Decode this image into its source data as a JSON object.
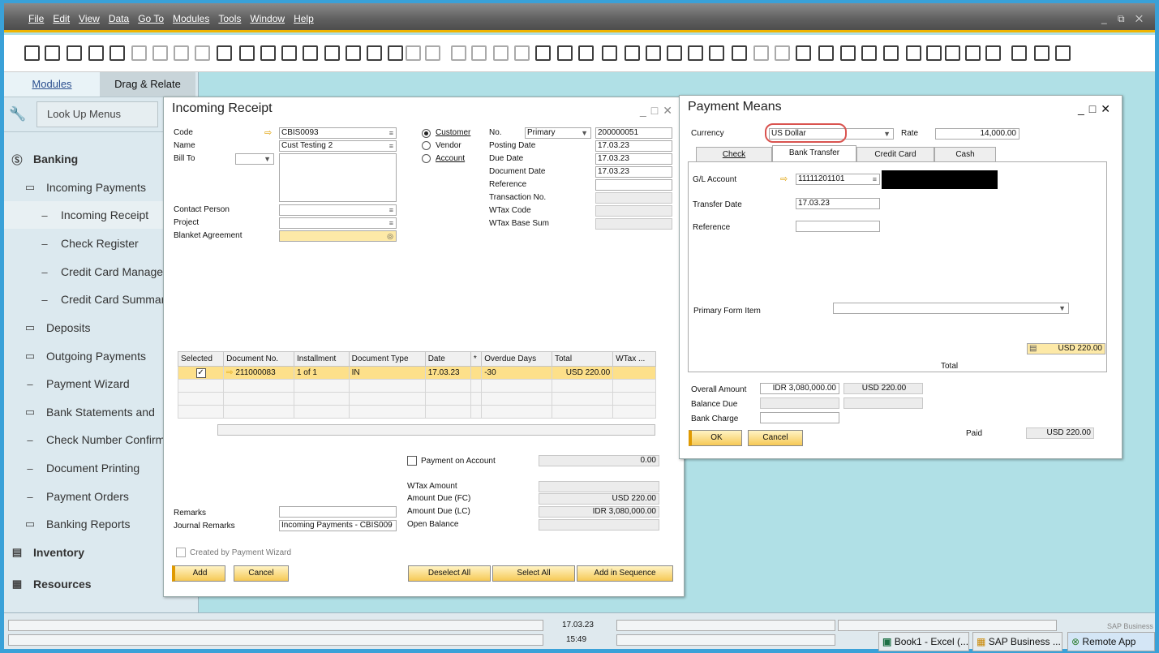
{
  "menubar": {
    "items": [
      "File",
      "Edit",
      "View",
      "Data",
      "Go To",
      "Modules",
      "Tools",
      "Window",
      "Help"
    ],
    "controls": "_ ⧉ ✕"
  },
  "sidebar": {
    "tabs": [
      "Modules",
      "Drag & Relate"
    ],
    "lookup_menus": "Look Up Menus",
    "items": [
      {
        "label": "Banking",
        "icon": "dollar-circle-icon"
      },
      {
        "label": "Incoming Payments",
        "icon": "folder-icon"
      },
      {
        "label": "Incoming Receipt",
        "icon": "dash-icon"
      },
      {
        "label": "Check Register",
        "icon": "dash-icon"
      },
      {
        "label": "Credit Card Management",
        "icon": "dash-icon"
      },
      {
        "label": "Credit Card Summary",
        "icon": "dash-icon"
      },
      {
        "label": "Deposits",
        "icon": "folder-icon"
      },
      {
        "label": "Outgoing Payments",
        "icon": "folder-icon"
      },
      {
        "label": "Payment Wizard",
        "icon": "dash-icon"
      },
      {
        "label": "Bank Statements and",
        "icon": "folder-icon"
      },
      {
        "label": "Check Number Confirmation",
        "icon": "dash-icon"
      },
      {
        "label": "Document Printing",
        "icon": "dash-icon"
      },
      {
        "label": "Payment Orders",
        "icon": "dash-icon"
      },
      {
        "label": "Banking Reports",
        "icon": "folder-icon"
      },
      {
        "label": "Inventory",
        "icon": "inventory-icon"
      },
      {
        "label": "Resources",
        "icon": "resources-icon"
      }
    ]
  },
  "incoming_receipt": {
    "title": "Incoming Receipt",
    "code_label": "Code",
    "code_value": "CBIS0093",
    "name_label": "Name",
    "name_value": "Cust Testing 2",
    "billto_label": "Bill To",
    "contact_label": "Contact Person",
    "project_label": "Project",
    "blanket_label": "Blanket Agreement",
    "radio_customer": "Customer",
    "radio_vendor": "Vendor",
    "radio_account": "Account",
    "no_label": "No.",
    "no_series": "Primary",
    "no_value": "200000051",
    "posting_label": "Posting Date",
    "posting_value": "17.03.23",
    "due_label": "Due Date",
    "due_value": "17.03.23",
    "docdate_label": "Document Date",
    "docdate_value": "17.03.23",
    "reference_label": "Reference",
    "transno_label": "Transaction No.",
    "wtaxcode_label": "WTax Code",
    "wtaxbase_label": "WTax Base Sum",
    "table": {
      "columns": [
        "Selected",
        "Document No.",
        "Installment",
        "Document Type",
        "Date",
        "*",
        "Overdue Days",
        "Total",
        "WTax ..."
      ],
      "row": {
        "checked": "✓",
        "doc_no": "211000083",
        "installment": "1 of 1",
        "doc_type": "IN",
        "date": "17.03.23",
        "star": "",
        "overdue": "-30",
        "total": "USD 220.00",
        "wtax": ""
      }
    },
    "payment_on_account": "Payment on Account",
    "payment_on_account_value": "0.00",
    "wtax_amount_label": "WTax Amount",
    "amount_due_fc_label": "Amount Due (FC)",
    "amount_due_fc_value": "USD 220.00",
    "amount_due_lc_label": "Amount Due (LC)",
    "amount_due_lc_value": "IDR 3,080,000.00",
    "open_balance_label": "Open Balance",
    "remarks_label": "Remarks",
    "journal_remarks_label": "Journal Remarks",
    "journal_remarks_value": "Incoming Payments - CBIS009",
    "created_by_wizard": "Created by Payment Wizard",
    "buttons": {
      "add": "Add",
      "cancel": "Cancel",
      "deselect_all": "Deselect All",
      "select_all": "Select All",
      "add_in_sequence": "Add in Sequence"
    }
  },
  "payment_means": {
    "title": "Payment Means",
    "currency_label": "Currency",
    "currency_value": "US Dollar",
    "rate_label": "Rate",
    "rate_value": "14,000.00",
    "tabs": [
      "Check",
      "Bank Transfer",
      "Credit Card",
      "Cash"
    ],
    "active_tab": "Bank Transfer",
    "gl_account_label": "G/L Account",
    "gl_account_value": "11111201101",
    "transfer_date_label": "Transfer Date",
    "transfer_date_value": "17.03.23",
    "reference_label": "Reference",
    "primary_form_item_label": "Primary Form Item",
    "total_value": "USD 220.00",
    "total_label": "Total",
    "overall_amount_label": "Overall Amount",
    "overall_amount_lc": "IDR 3,080,000.00",
    "overall_amount_fc": "USD 220.00",
    "balance_due_label": "Balance Due",
    "bank_charge_label": "Bank Charge",
    "paid_label": "Paid",
    "paid_value": "USD 220.00",
    "ok_label": "OK",
    "cancel_label": "Cancel",
    "highlight_color": "#d9534f"
  },
  "statusbar": {
    "date": "17.03.23",
    "time": "15:49",
    "brand": "SAP Business"
  },
  "taskbar": {
    "excel": "Book1 - Excel (...",
    "sap": "SAP Business ...",
    "remote": "Remote App"
  }
}
